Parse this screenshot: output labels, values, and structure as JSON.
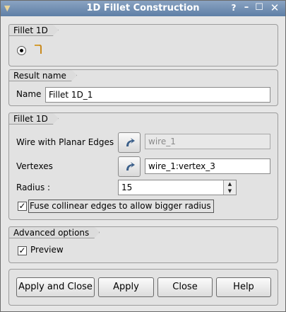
{
  "window": {
    "title": "1D Fillet Construction",
    "help_glyph": "?",
    "minimize_glyph": "–",
    "maximize_glyph": "☐",
    "close_glyph": "✕"
  },
  "fillet_type": {
    "title": "Fillet 1D",
    "selected": "constructor-1"
  },
  "result": {
    "title": "Result name",
    "name_label": "Name",
    "name_value": "Fillet 1D_1"
  },
  "args": {
    "title": "Fillet 1D",
    "wire_label": "Wire with Planar Edges",
    "wire_value": "wire_1",
    "vertex_label": "Vertexes",
    "vertex_value": "wire_1:vertex_3",
    "radius_label": "Radius :",
    "radius_value": "15",
    "fuse_label": "Fuse collinear edges to allow bigger radius",
    "fuse_checked": true
  },
  "advanced": {
    "title": "Advanced options",
    "preview_label": "Preview",
    "preview_checked": true
  },
  "buttons": {
    "apply_close": "Apply and Close",
    "apply": "Apply",
    "close": "Close",
    "help": "Help"
  },
  "colors": {
    "titlebar_top": "#8aa3c2",
    "titlebar_bottom": "#5e7fa6",
    "accent_arrow": "#3b5f8a"
  }
}
